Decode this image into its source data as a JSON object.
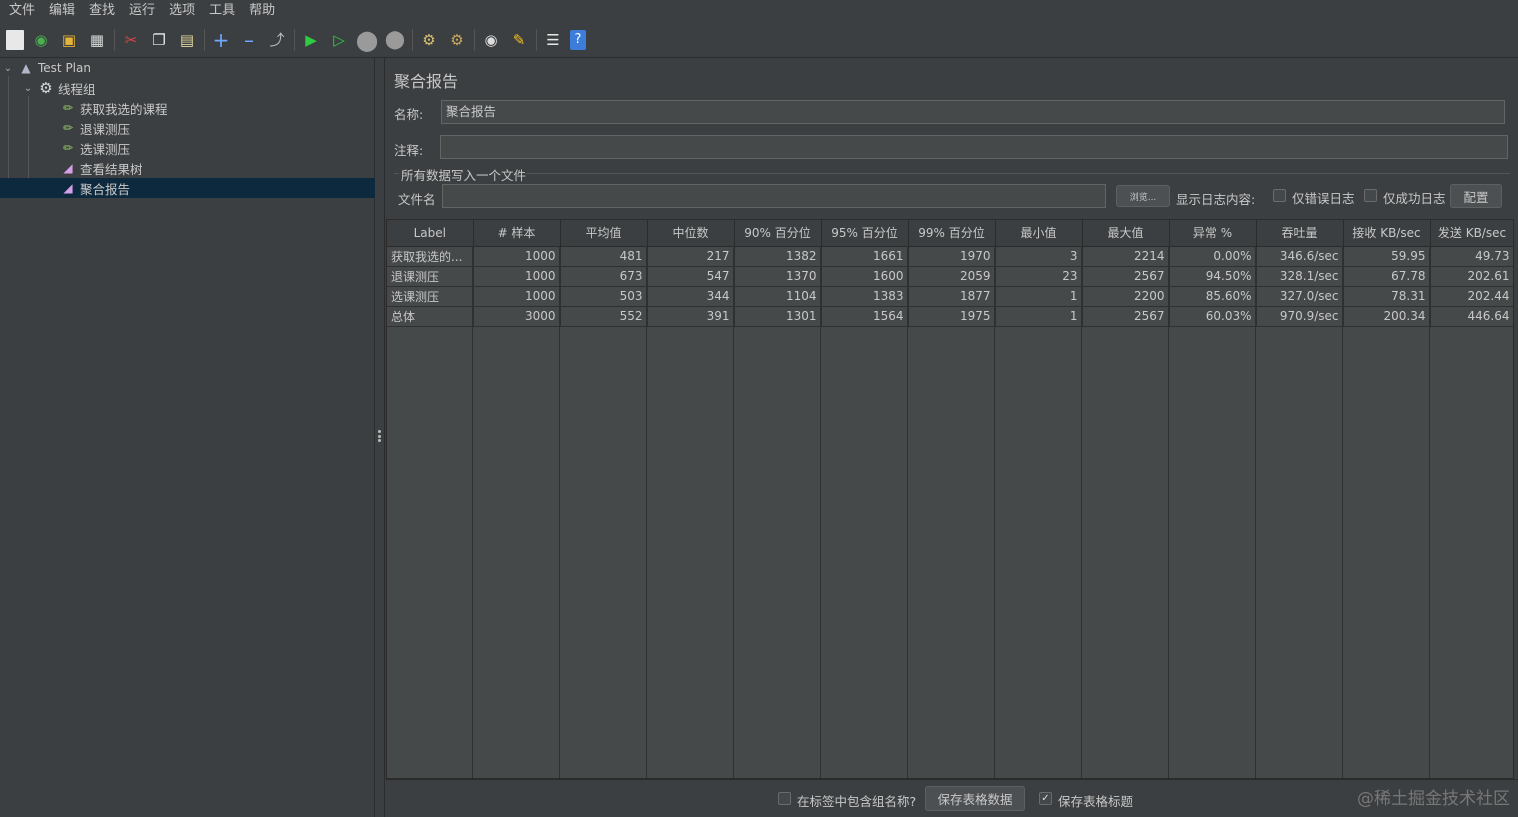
{
  "menu": [
    "文件",
    "编辑",
    "查找",
    "运行",
    "选项",
    "工具",
    "帮助"
  ],
  "toolbar": {
    "icons": [
      "new-icon",
      "templates-icon",
      "open-icon",
      "save-icon",
      "cut-icon",
      "copy-icon",
      "paste-icon",
      "expand-icon",
      "collapse-icon",
      "toggle-icon",
      "start-icon",
      "start-no-pause-icon",
      "stop-icon",
      "shutdown-icon",
      "clear-icon",
      "clear-all-icon",
      "search-icon",
      "reset-search-icon",
      "function-helper-icon",
      "help-icon"
    ]
  },
  "tree": {
    "items": [
      {
        "label": "Test Plan",
        "icon": "test-plan-icon"
      },
      {
        "label": "线程组",
        "icon": "thread-group-icon"
      },
      {
        "label": "获取我选的课程",
        "icon": "sampler-icon"
      },
      {
        "label": "退课测压",
        "icon": "sampler-icon"
      },
      {
        "label": "选课测压",
        "icon": "sampler-icon"
      },
      {
        "label": "查看结果树",
        "icon": "listener-icon"
      },
      {
        "label": "聚合报告",
        "icon": "listener-icon"
      }
    ]
  },
  "panel": {
    "title": "聚合报告",
    "name_label": "名称:",
    "name_value": "聚合报告",
    "comment_label": "注释:",
    "comment_value": "",
    "file_group_label": "所有数据写入一个文件",
    "filename_label": "文件名",
    "filename_value": "",
    "browse_button": "浏览...",
    "log_display_label": "显示日志内容:",
    "errors_only_label": "仅错误日志",
    "success_only_label": "仅成功日志",
    "config_button": "配置"
  },
  "table": {
    "headers": [
      "Label",
      "# 样本",
      "平均值",
      "中位数",
      "90% 百分位",
      "95% 百分位",
      "99% 百分位",
      "最小值",
      "最大值",
      "异常 %",
      "吞吐量",
      "接收 KB/sec",
      "发送 KB/sec"
    ],
    "rows": [
      [
        "获取我选的...",
        "1000",
        "481",
        "217",
        "1382",
        "1661",
        "1970",
        "3",
        "2214",
        "0.00%",
        "346.6/sec",
        "59.95",
        "49.73"
      ],
      [
        "退课测压",
        "1000",
        "673",
        "547",
        "1370",
        "1600",
        "2059",
        "23",
        "2567",
        "94.50%",
        "328.1/sec",
        "67.78",
        "202.61"
      ],
      [
        "选课测压",
        "1000",
        "503",
        "344",
        "1104",
        "1383",
        "1877",
        "1",
        "2200",
        "85.60%",
        "327.0/sec",
        "78.31",
        "202.44"
      ],
      [
        "总体",
        "3000",
        "552",
        "391",
        "1301",
        "1564",
        "1975",
        "1",
        "2567",
        "60.03%",
        "970.9/sec",
        "200.34",
        "446.64"
      ]
    ]
  },
  "bottom": {
    "include_group_label": "在标签中包含组名称?",
    "save_table_button": "保存表格数据",
    "save_header_label": "保存表格标题",
    "save_header_checked": true
  },
  "watermark": "@稀土掘金技术社区"
}
